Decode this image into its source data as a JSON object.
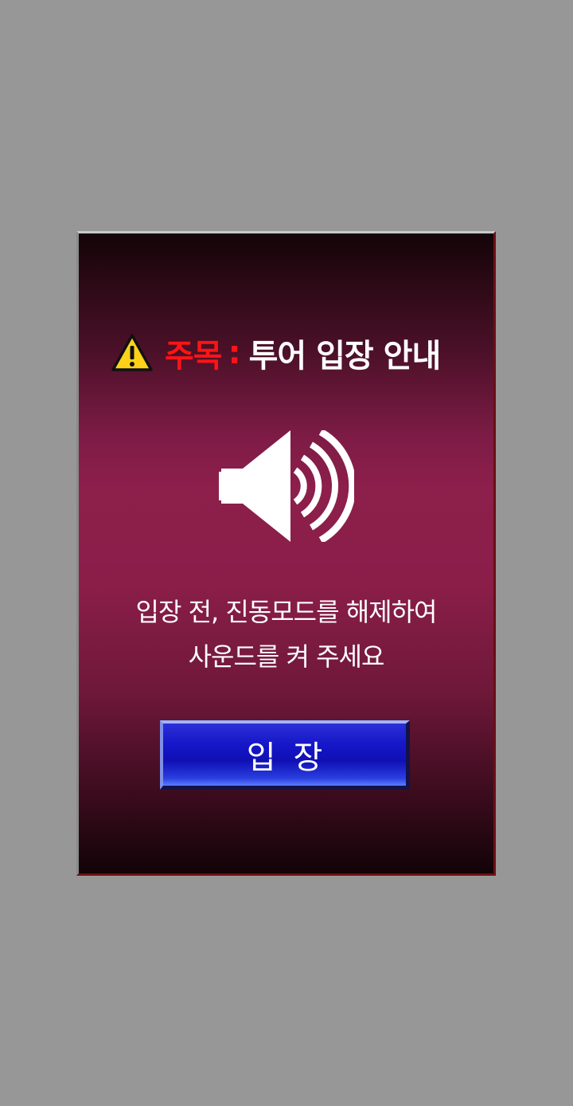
{
  "dialog": {
    "title": {
      "attention": "주목",
      "colon": ":",
      "text": "투어 입장 안내"
    },
    "icons": {
      "warning": "warning-triangle-icon",
      "speaker": "speaker-sound-icon"
    },
    "message": {
      "line1": "입장 전, 진동모드를 해제하여",
      "line2": "사운드를 켜 주세요"
    },
    "enter_button": {
      "label": "입장"
    }
  },
  "colors": {
    "page_background": "#979797",
    "dialog_mid": "#8d1f4b",
    "attention_red": "#ff1414",
    "button_blue": "#1516c8",
    "text_white": "#ffffff"
  }
}
